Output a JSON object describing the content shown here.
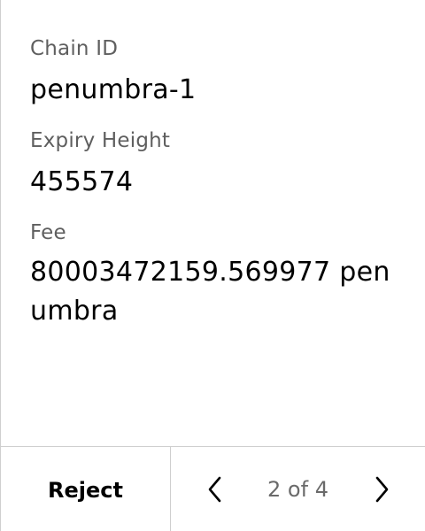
{
  "fields": {
    "chain_id": {
      "label": "Chain ID",
      "value": "penumbra-1"
    },
    "expiry_height": {
      "label": "Expiry Height",
      "value": "455574"
    },
    "fee": {
      "label": "Fee",
      "value": "80003472159.569977 penumbra"
    }
  },
  "footer": {
    "reject_label": "Reject",
    "page_indicator": "2 of 4",
    "prev_icon": "chevron-left-icon",
    "next_icon": "chevron-right-icon"
  }
}
